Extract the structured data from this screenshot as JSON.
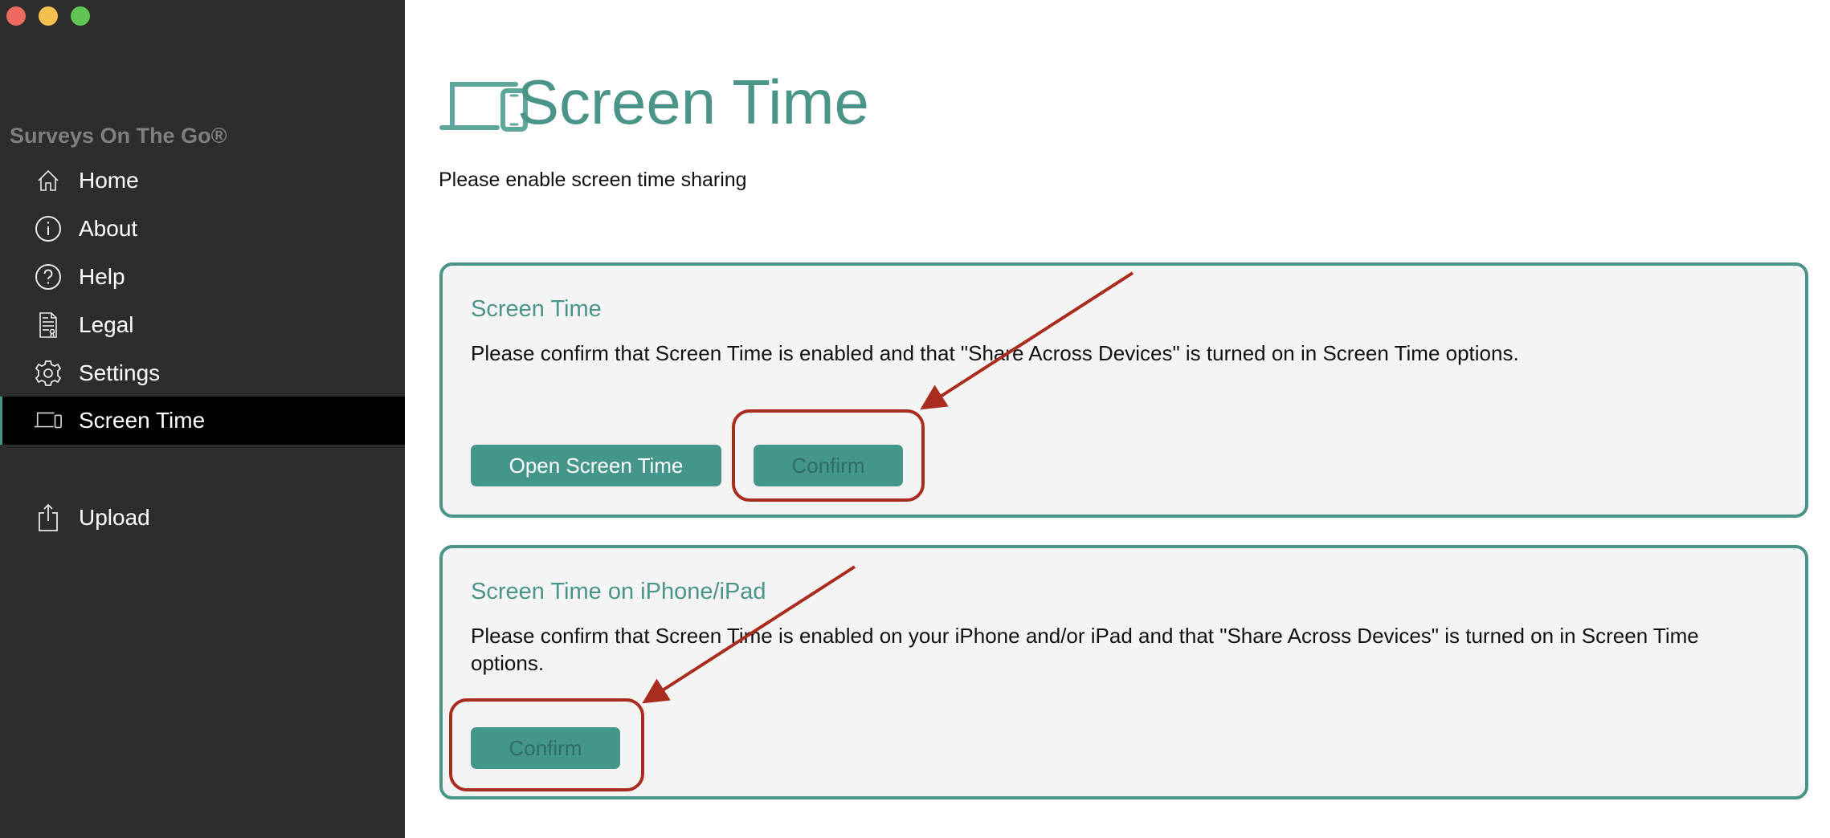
{
  "window": {
    "controls": [
      "close",
      "minimize",
      "zoom"
    ]
  },
  "sidebar": {
    "brand": "Surveys On The Go®",
    "items": [
      {
        "label": "Home",
        "icon": "home-icon",
        "selected": false
      },
      {
        "label": "About",
        "icon": "info-icon",
        "selected": false
      },
      {
        "label": "Help",
        "icon": "help-icon",
        "selected": false
      },
      {
        "label": "Legal",
        "icon": "legal-document-icon",
        "selected": false
      },
      {
        "label": "Settings",
        "icon": "gear-icon",
        "selected": false
      },
      {
        "label": "Screen Time",
        "icon": "laptop-phone-icon",
        "selected": true
      },
      {
        "label": "Upload",
        "icon": "upload-icon",
        "selected": false
      }
    ]
  },
  "main": {
    "header_icon": "laptop-phone-icon",
    "title": "Screen Time",
    "subtitle": "Please enable screen time sharing",
    "cards": [
      {
        "title": "Screen Time",
        "description": "Please confirm that Screen Time is enabled and that \"Share Across Devices\" is turned on in Screen Time options.",
        "buttons": [
          {
            "label": "Open Screen Time",
            "state": "enabled"
          },
          {
            "label": "Confirm",
            "state": "disabled"
          }
        ]
      },
      {
        "title": "Screen Time on iPhone/iPad",
        "description": "Please confirm that Screen Time is enabled on your iPhone and/or iPad and that \"Share Across Devices\" is turned on in Screen Time options.",
        "buttons": [
          {
            "label": "Confirm",
            "state": "disabled"
          }
        ]
      }
    ]
  },
  "colors": {
    "accent": "#4a9488",
    "button": "#44958a",
    "sidebar_bg": "#2d2d2d",
    "card_bg": "#f4f4f4",
    "annotation": "#a92d1e"
  }
}
